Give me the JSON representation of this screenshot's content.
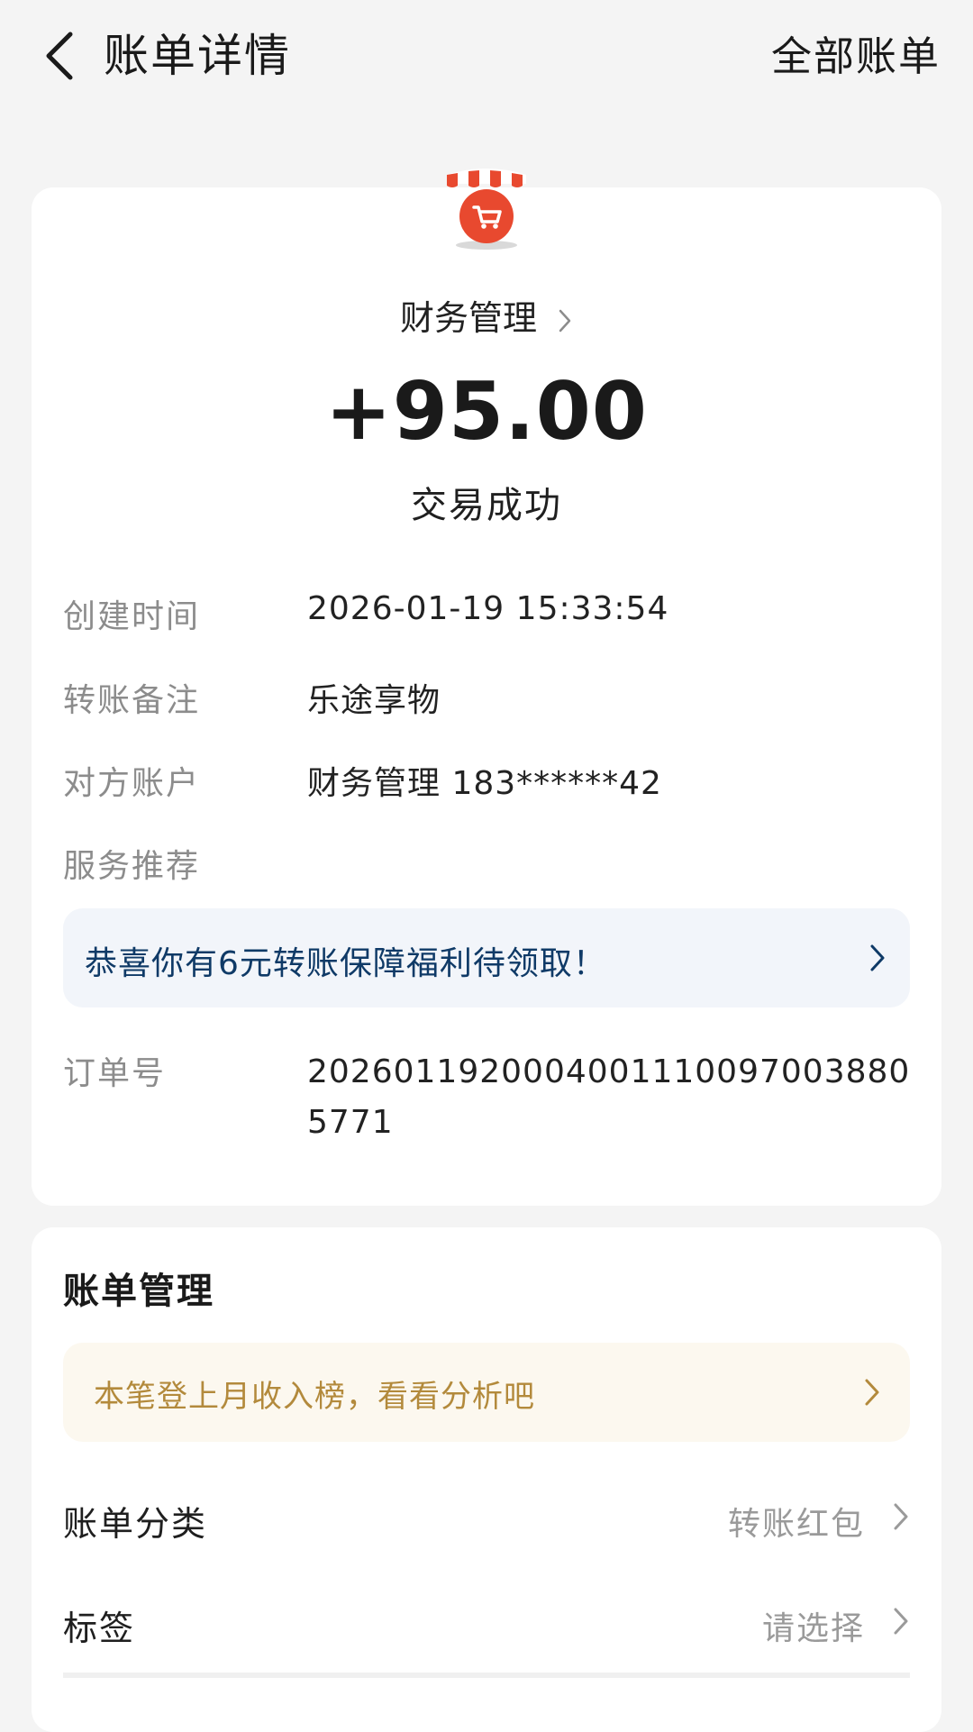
{
  "header": {
    "title": "账单详情",
    "all_bills_label": "全部账单"
  },
  "transaction": {
    "merchant_icon": "shop-cart-icon",
    "merchant_name": "财务管理",
    "amount": "+95.00",
    "status": "交易成功"
  },
  "details": [
    {
      "label": "创建时间",
      "value": "2026-01-19 15:33:54"
    },
    {
      "label": "转账备注",
      "value": "乐途享物"
    },
    {
      "label": "对方账户",
      "value": "财务管理 183******42"
    },
    {
      "label": "服务推荐",
      "value": ""
    }
  ],
  "promo": {
    "text": "恭喜你有6元转账保障福利待领取！"
  },
  "order": {
    "label": "订单号",
    "value": "20260119200040011100970038805771"
  },
  "manage": {
    "title": "账单管理",
    "analysis_text": "本笔登上月收入榜，看看分析吧",
    "category_label": "账单分类",
    "category_value": "转账红包",
    "tag_label": "标签",
    "tag_value": "请选择"
  },
  "colors": {
    "background": "#f4f4f4",
    "promo_text": "#0f3a67",
    "analysis_text": "#b38a3c",
    "icon_red": "#e8492f"
  }
}
